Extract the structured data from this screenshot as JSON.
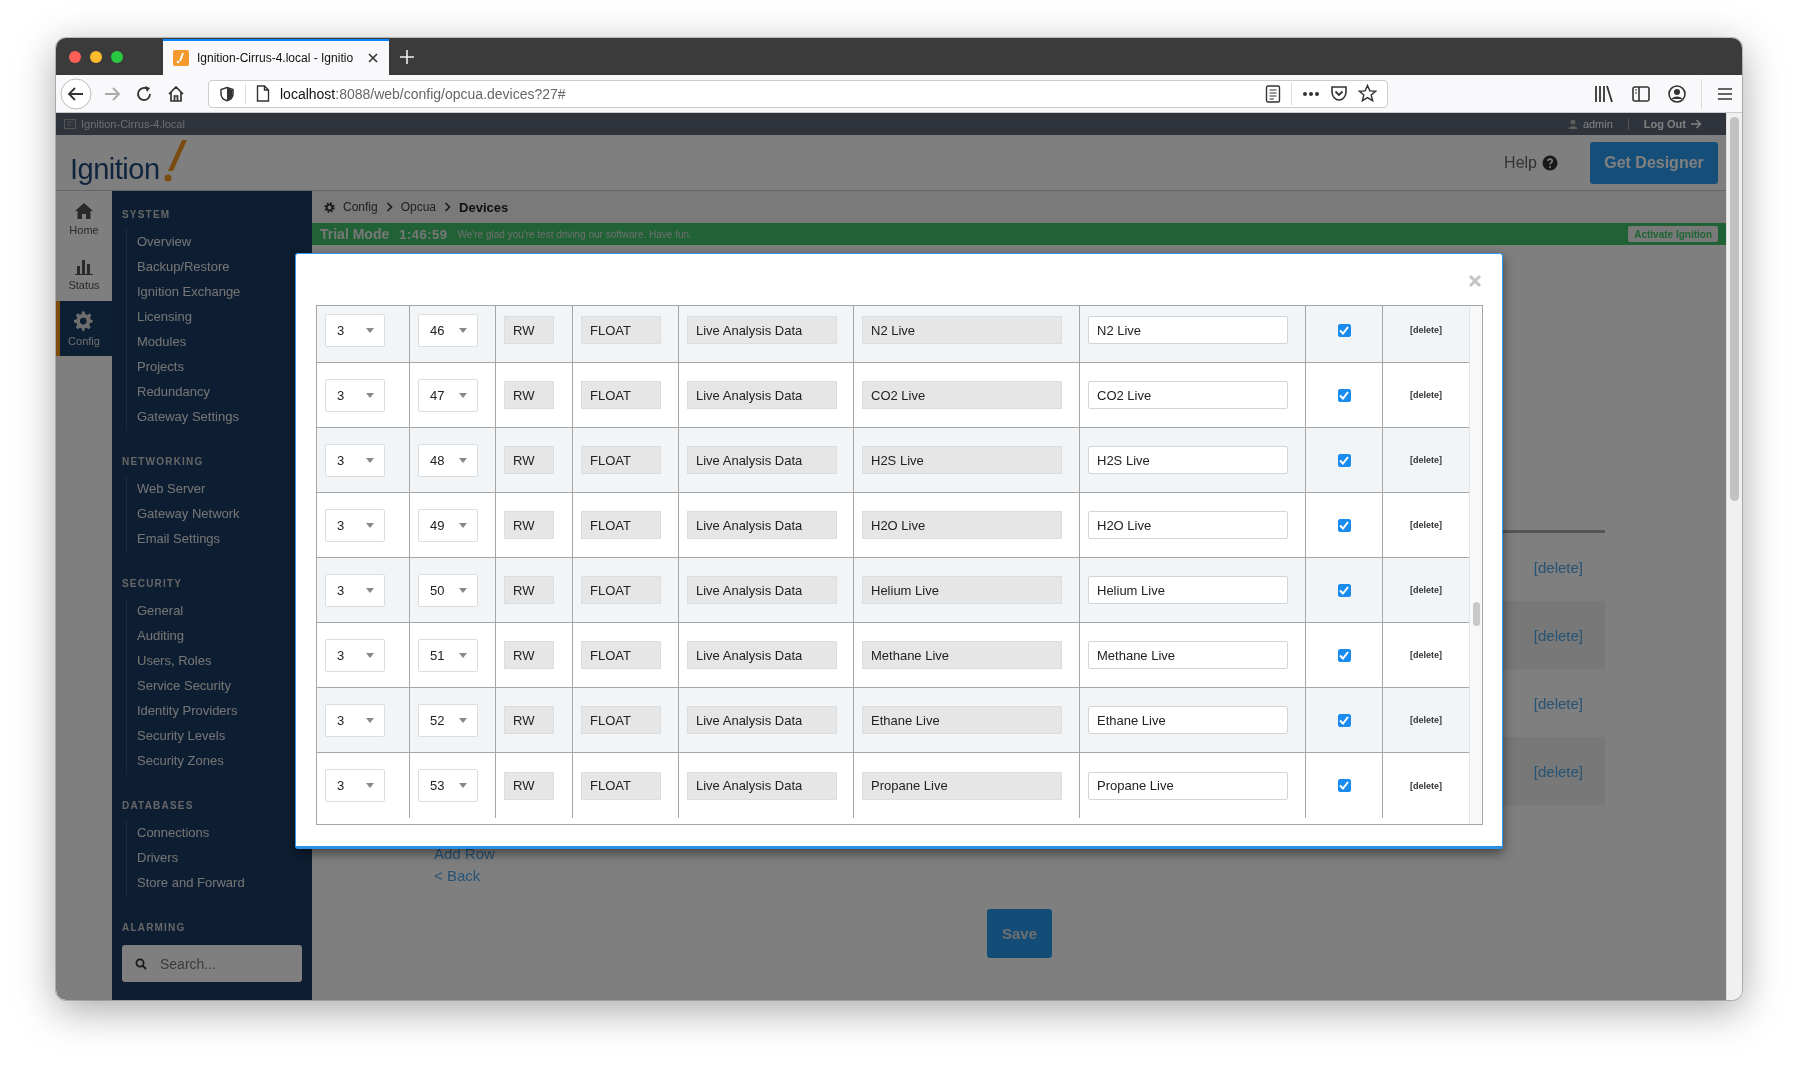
{
  "browser": {
    "tab_title": "Ignition-Cirrus-4.local - Ignitio",
    "url_host": "localhost",
    "url_rest": ":8088/web/config/opcua.devices?27#"
  },
  "topbar": {
    "host": "Ignition-Cirrus-4.local",
    "user": "admin",
    "logout": "Log Out"
  },
  "header": {
    "logo": "Ignition",
    "help": "Help",
    "designer": "Get Designer"
  },
  "rail": [
    {
      "label": "Home",
      "kind": "home",
      "selected": false
    },
    {
      "label": "Status",
      "kind": "status",
      "selected": false
    },
    {
      "label": "Config",
      "kind": "config",
      "selected": true
    }
  ],
  "sidebar": {
    "sections": [
      {
        "title": "SYSTEM",
        "items": [
          "Overview",
          "Backup/Restore",
          "Ignition Exchange",
          "Licensing",
          "Modules",
          "Projects",
          "Redundancy",
          "Gateway Settings"
        ]
      },
      {
        "title": "NETWORKING",
        "items": [
          "Web Server",
          "Gateway Network",
          "Email Settings"
        ]
      },
      {
        "title": "SECURITY",
        "items": [
          "General",
          "Auditing",
          "Users, Roles",
          "Service Security",
          "Identity Providers",
          "Security Levels",
          "Security Zones"
        ]
      },
      {
        "title": "DATABASES",
        "items": [
          "Connections",
          "Drivers",
          "Store and Forward"
        ]
      },
      {
        "title": "ALARMING"
      }
    ],
    "search_placeholder": "Search..."
  },
  "breadcrumb": [
    "Config",
    "Opcua",
    "Devices"
  ],
  "trial": {
    "title": "Trial Mode",
    "time": "1:46:59",
    "message": "We're glad you're test driving our software. Have fun.",
    "button": "Activate Ignition"
  },
  "modal": {
    "rows": [
      {
        "namespace": "3",
        "id": "46",
        "access": "RW",
        "type": "FLOAT",
        "group": "Live Analysis Data",
        "name": "N2 Live",
        "alias": "N2 Live",
        "checked": true,
        "delete": "[delete]"
      },
      {
        "namespace": "3",
        "id": "47",
        "access": "RW",
        "type": "FLOAT",
        "group": "Live Analysis Data",
        "name": "CO2 Live",
        "alias": "CO2 Live",
        "checked": true,
        "delete": "[delete]"
      },
      {
        "namespace": "3",
        "id": "48",
        "access": "RW",
        "type": "FLOAT",
        "group": "Live Analysis Data",
        "name": "H2S Live",
        "alias": "H2S Live",
        "checked": true,
        "delete": "[delete]"
      },
      {
        "namespace": "3",
        "id": "49",
        "access": "RW",
        "type": "FLOAT",
        "group": "Live Analysis Data",
        "name": "H2O Live",
        "alias": "H2O Live",
        "checked": true,
        "delete": "[delete]"
      },
      {
        "namespace": "3",
        "id": "50",
        "access": "RW",
        "type": "FLOAT",
        "group": "Live Analysis Data",
        "name": "Helium Live",
        "alias": "Helium Live",
        "checked": true,
        "delete": "[delete]"
      },
      {
        "namespace": "3",
        "id": "51",
        "access": "RW",
        "type": "FLOAT",
        "group": "Live Analysis Data",
        "name": "Methane Live",
        "alias": "Methane Live",
        "checked": true,
        "delete": "[delete]"
      },
      {
        "namespace": "3",
        "id": "52",
        "access": "RW",
        "type": "FLOAT",
        "group": "Live Analysis Data",
        "name": "Ethane Live",
        "alias": "Ethane Live",
        "checked": true,
        "delete": "[delete]"
      },
      {
        "namespace": "3",
        "id": "53",
        "access": "RW",
        "type": "FLOAT",
        "group": "Live Analysis Data",
        "name": "Propane Live",
        "alias": "Propane Live",
        "checked": true,
        "delete": "[delete]"
      }
    ]
  },
  "background": {
    "deletes": [
      "[delete]",
      "[delete]",
      "[delete]",
      "[delete]"
    ],
    "add_row": "Add Row",
    "back": "< Back",
    "save": "Save"
  }
}
